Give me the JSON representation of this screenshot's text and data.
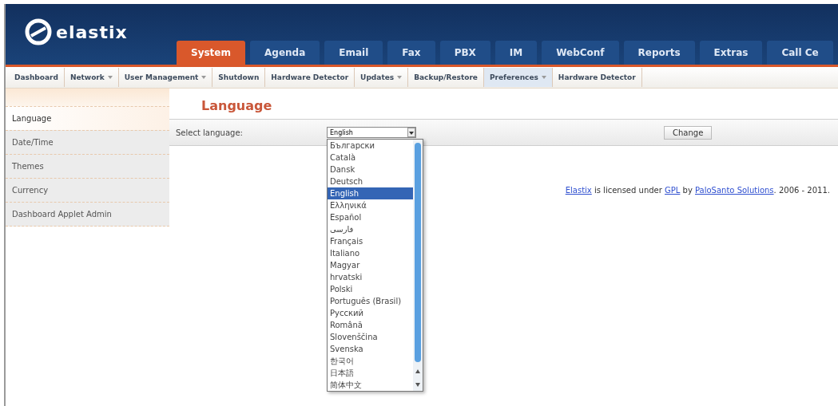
{
  "logo": {
    "text": "elastix"
  },
  "main_tabs": [
    {
      "label": "System",
      "selected": true
    },
    {
      "label": "Agenda",
      "selected": false
    },
    {
      "label": "Email",
      "selected": false
    },
    {
      "label": "Fax",
      "selected": false
    },
    {
      "label": "PBX",
      "selected": false
    },
    {
      "label": "IM",
      "selected": false
    },
    {
      "label": "WebConf",
      "selected": false
    },
    {
      "label": "Reports",
      "selected": false
    },
    {
      "label": "Extras",
      "selected": false
    },
    {
      "label": "Call Ce",
      "selected": false
    }
  ],
  "sub_tabs": [
    {
      "label": "Dashboard",
      "has_menu": false,
      "selected": false
    },
    {
      "label": "Network",
      "has_menu": true,
      "selected": false
    },
    {
      "label": "User Management",
      "has_menu": true,
      "selected": false
    },
    {
      "label": "Shutdown",
      "has_menu": false,
      "selected": false
    },
    {
      "label": "Hardware Detector",
      "has_menu": false,
      "selected": false
    },
    {
      "label": "Updates",
      "has_menu": true,
      "selected": false
    },
    {
      "label": "Backup/Restore",
      "has_menu": false,
      "selected": false
    },
    {
      "label": "Preferences",
      "has_menu": true,
      "selected": true
    },
    {
      "label": "Hardware Detector",
      "has_menu": false,
      "selected": false
    }
  ],
  "sidebar": {
    "items": [
      {
        "label": "Language",
        "selected": true
      },
      {
        "label": "Date/Time",
        "selected": false
      },
      {
        "label": "Themes",
        "selected": false
      },
      {
        "label": "Currency",
        "selected": false
      },
      {
        "label": "Dashboard Applet Admin",
        "selected": false
      }
    ]
  },
  "page": {
    "title": "Language",
    "form": {
      "label": "Select language:",
      "select_value": "English",
      "button": "Change",
      "options": [
        {
          "label": "Български",
          "selected": false
        },
        {
          "label": "Català",
          "selected": false
        },
        {
          "label": "Dansk",
          "selected": false
        },
        {
          "label": "Deutsch",
          "selected": false
        },
        {
          "label": "English",
          "selected": true
        },
        {
          "label": "Ελληνικά",
          "selected": false
        },
        {
          "label": "Español",
          "selected": false
        },
        {
          "label": "فارسی",
          "selected": false
        },
        {
          "label": "Français",
          "selected": false
        },
        {
          "label": "Italiano",
          "selected": false
        },
        {
          "label": "Magyar",
          "selected": false
        },
        {
          "label": "hrvatski",
          "selected": false
        },
        {
          "label": "Polski",
          "selected": false
        },
        {
          "label": "Português (Brasil)",
          "selected": false
        },
        {
          "label": "Русский",
          "selected": false
        },
        {
          "label": "Română",
          "selected": false
        },
        {
          "label": "Slovenščina",
          "selected": false
        },
        {
          "label": "Svenska",
          "selected": false
        },
        {
          "label": "한국어",
          "selected": false
        },
        {
          "label": "日本語",
          "selected": false
        },
        {
          "label": "简体中文",
          "selected": false
        }
      ]
    },
    "footer": [
      {
        "kind": "link",
        "text": "Elastix"
      },
      {
        "kind": "text",
        "text": " is licensed under "
      },
      {
        "kind": "link",
        "text": "GPL"
      },
      {
        "kind": "text",
        "text": " by "
      },
      {
        "kind": "link",
        "text": "PaloSanto Solutions"
      },
      {
        "kind": "text",
        "text": ". 2006 - 2011."
      }
    ]
  }
}
